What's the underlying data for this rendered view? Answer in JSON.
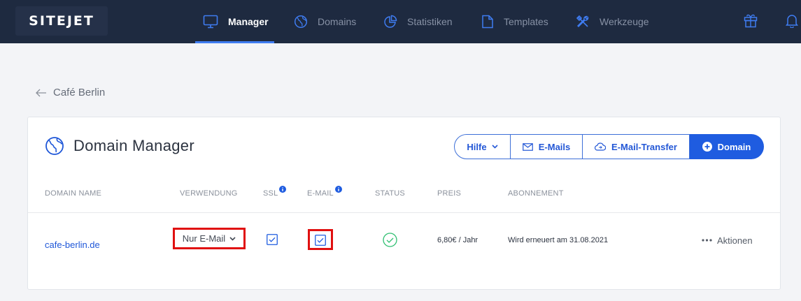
{
  "header": {
    "logo": "SITEJET",
    "nav": [
      {
        "label": "Manager",
        "icon": "monitor-icon",
        "active": true
      },
      {
        "label": "Domains",
        "icon": "globe-icon",
        "active": false
      },
      {
        "label": "Statistiken",
        "icon": "pie-chart-icon",
        "active": false
      },
      {
        "label": "Templates",
        "icon": "document-icon",
        "active": false
      },
      {
        "label": "Werkzeuge",
        "icon": "tools-icon",
        "active": false
      }
    ],
    "right_icons": [
      "gift-icon",
      "bell-icon"
    ]
  },
  "breadcrumb": {
    "label": "Café Berlin",
    "icon": "arrow-left-icon"
  },
  "card": {
    "title": "Domain Manager",
    "title_icon": "globe-icon",
    "buttons": {
      "help": "Hilfe",
      "emails": "E-Mails",
      "transfer": "E-Mail-Transfer",
      "add_domain": "Domain"
    },
    "columns": {
      "domain": "DOMAIN NAME",
      "usage": "VERWENDUNG",
      "ssl": "SSL",
      "email": "E-MAIL",
      "status": "STATUS",
      "price": "PREIS",
      "subscription": "ABONNEMENT"
    },
    "rows": [
      {
        "domain": "cafe-berlin.de",
        "usage": "Nur E-Mail",
        "ssl": true,
        "email": true,
        "status": "ok",
        "price": "6,80€ / Jahr",
        "subscription": "Wird erneuert am 31.08.2021",
        "actions": "Aktionen"
      }
    ]
  },
  "colors": {
    "topbar": "#1e2a40",
    "accent": "#1f5ce0",
    "link": "#1f57d8",
    "success": "#2fbf71",
    "highlight": "#e01010"
  }
}
